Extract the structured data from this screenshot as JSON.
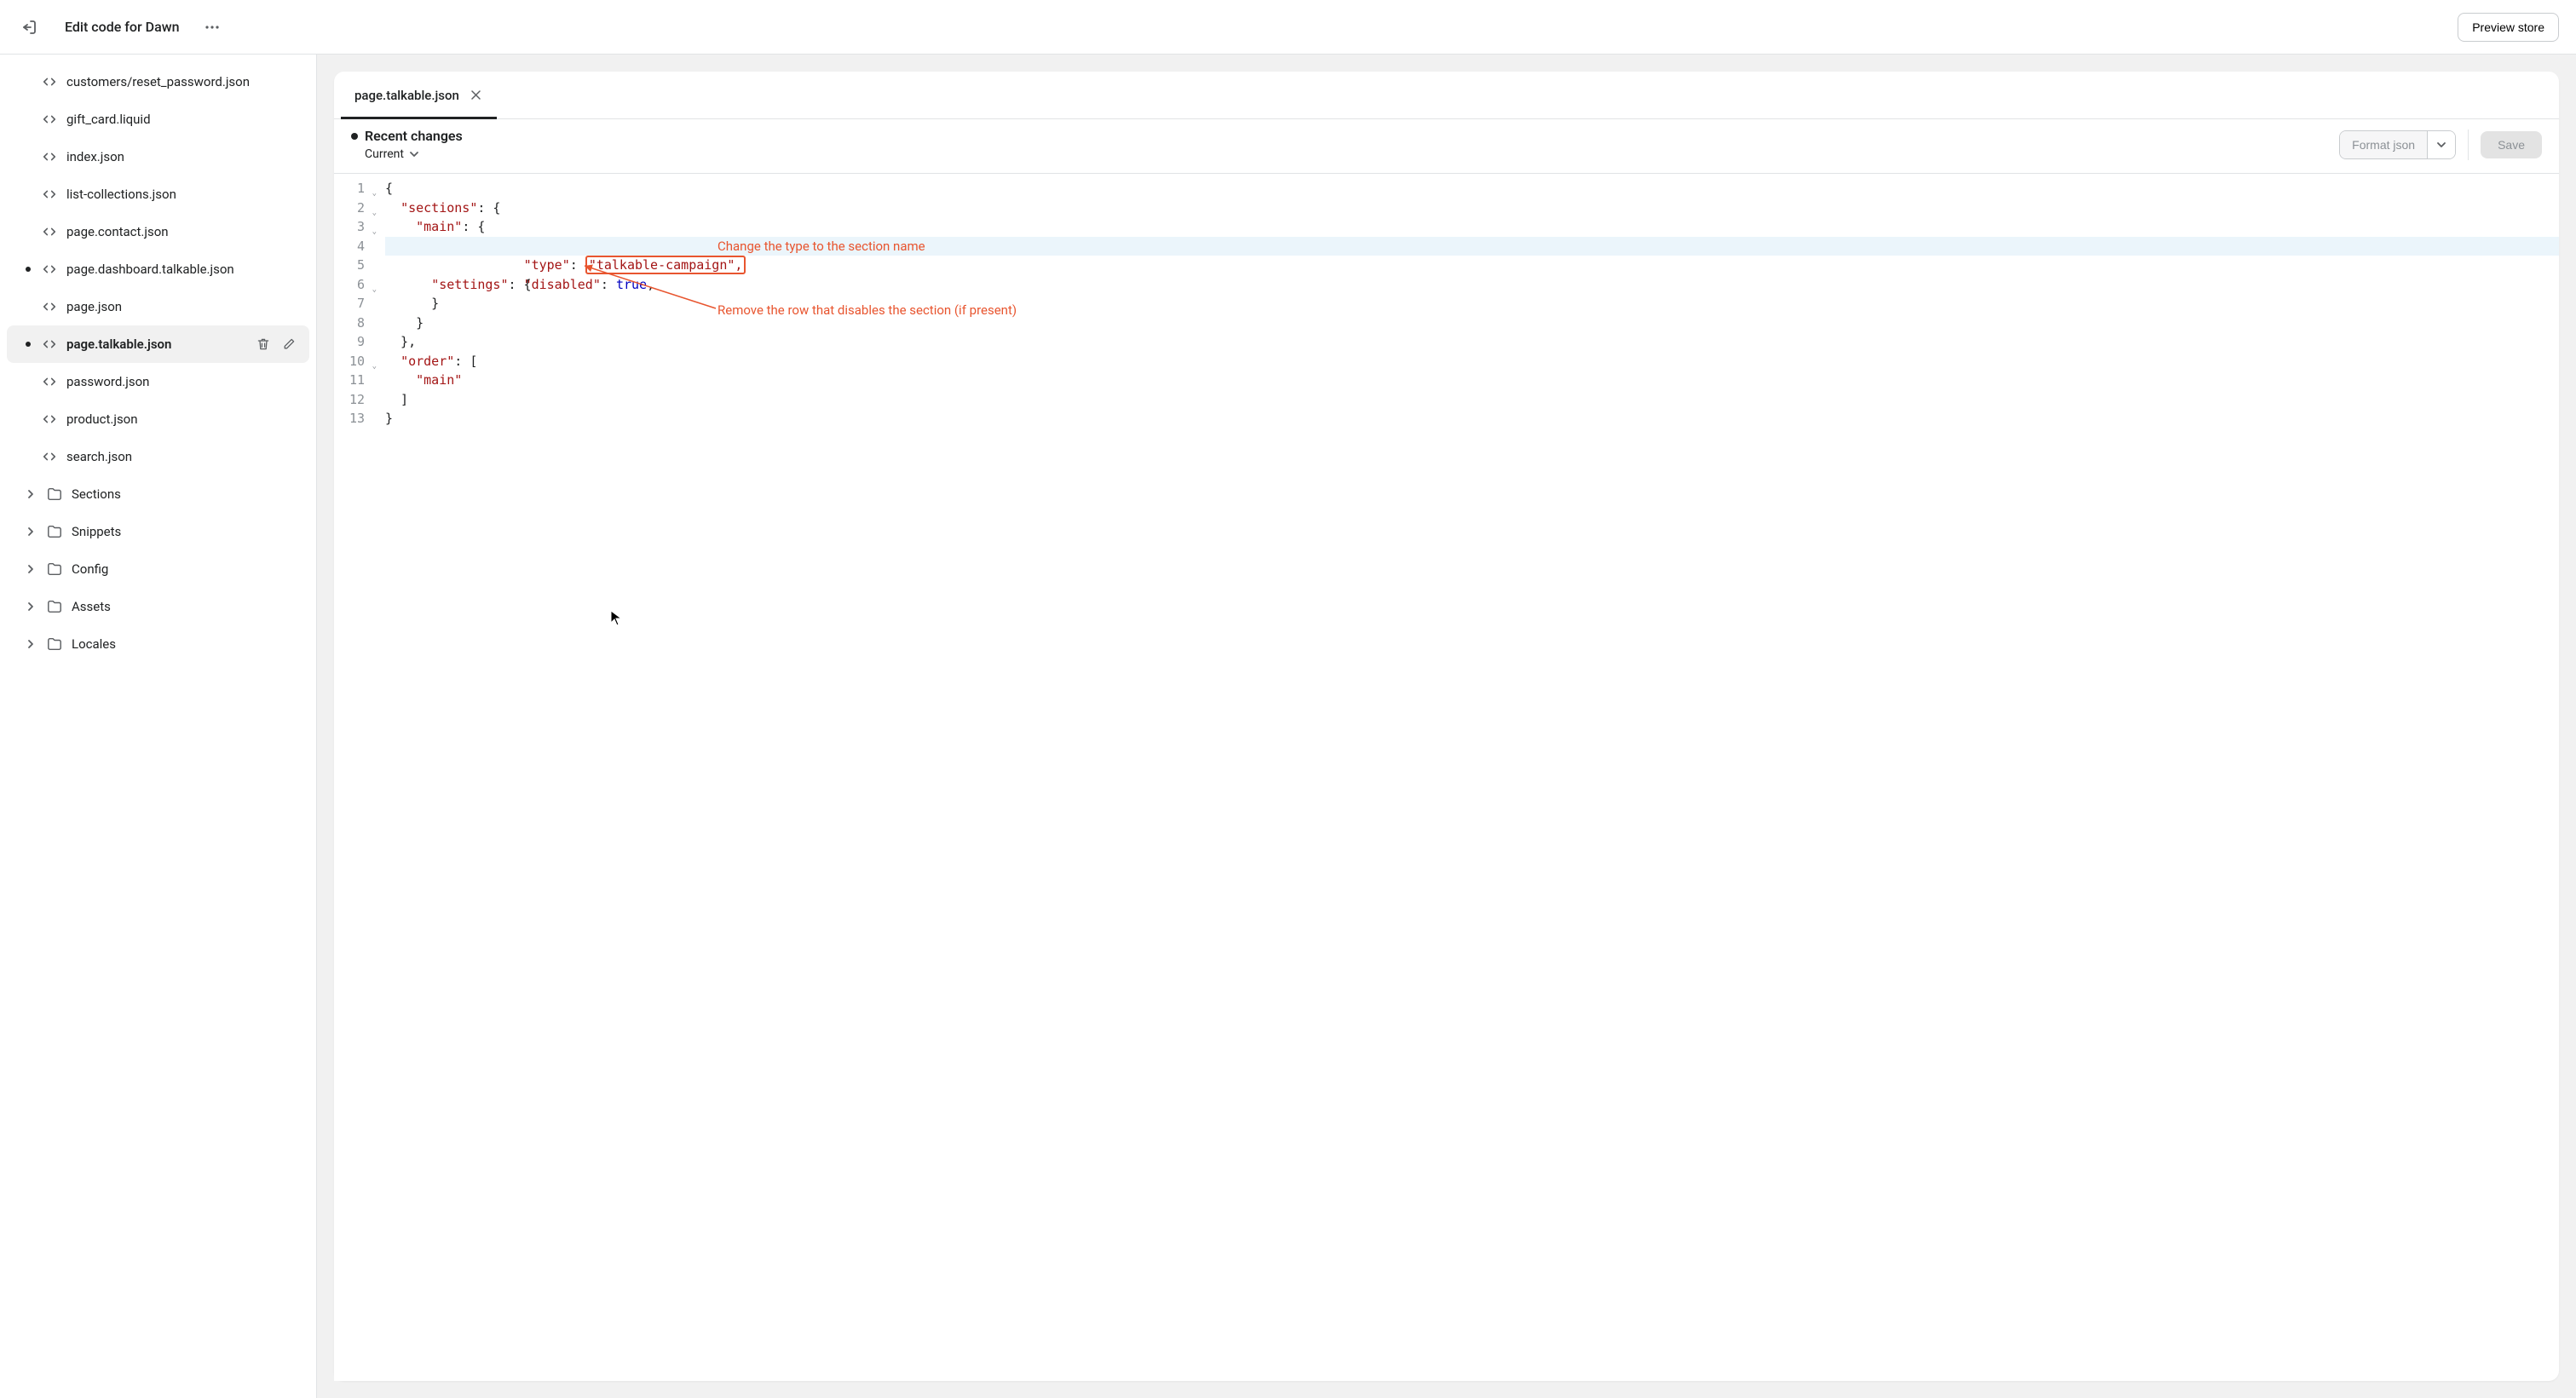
{
  "header": {
    "title": "Edit code for Dawn",
    "preview_label": "Preview store"
  },
  "sidebar": {
    "files": [
      {
        "name": "customers/reset_password.json",
        "modified": false,
        "active": false
      },
      {
        "name": "gift_card.liquid",
        "modified": false,
        "active": false
      },
      {
        "name": "index.json",
        "modified": false,
        "active": false
      },
      {
        "name": "list-collections.json",
        "modified": false,
        "active": false
      },
      {
        "name": "page.contact.json",
        "modified": false,
        "active": false
      },
      {
        "name": "page.dashboard.talkable.json",
        "modified": true,
        "active": false
      },
      {
        "name": "page.json",
        "modified": false,
        "active": false
      },
      {
        "name": "page.talkable.json",
        "modified": true,
        "active": true
      },
      {
        "name": "password.json",
        "modified": false,
        "active": false
      },
      {
        "name": "product.json",
        "modified": false,
        "active": false
      },
      {
        "name": "search.json",
        "modified": false,
        "active": false
      }
    ],
    "folders": [
      {
        "name": "Sections"
      },
      {
        "name": "Snippets"
      },
      {
        "name": "Config"
      },
      {
        "name": "Assets"
      },
      {
        "name": "Locales"
      }
    ]
  },
  "editor": {
    "tab_label": "page.talkable.json",
    "recent_title": "Recent changes",
    "version_label": "Current",
    "format_label": "Format json",
    "save_label": "Save",
    "annotations": {
      "type_note": "Change the type to the section name",
      "disabled_note": "Remove the row that disables the section (if present)"
    },
    "code": {
      "line1": "{",
      "line2_indent": "  ",
      "line2_key": "\"sections\"",
      "line2_rest": ": {",
      "line3_indent": "    ",
      "line3_key": "\"main\"",
      "line3_rest": ": {",
      "line4_indent": "      ",
      "line4_key": "\"type\"",
      "line4_colon": ": ",
      "line4_val": "\"talkable-campaign\",",
      "line5_indent": "      ",
      "line5_key": "\"disabled\"",
      "line5_colon": ": ",
      "line5_val": "true",
      "line5_comma": ",",
      "line6_indent": "      ",
      "line6_key": "\"settings\"",
      "line6_rest": ": {",
      "line7": "      }",
      "line8": "    }",
      "line9": "  },",
      "line10_indent": "  ",
      "line10_key": "\"order\"",
      "line10_rest": ": [",
      "line11_indent": "    ",
      "line11_val": "\"main\"",
      "line12": "  ]",
      "line13": "}"
    },
    "line_numbers": [
      "1",
      "2",
      "3",
      "4",
      "5",
      "6",
      "7",
      "8",
      "9",
      "10",
      "11",
      "12",
      "13"
    ],
    "fold_lines": [
      1,
      2,
      3,
      6,
      10
    ]
  }
}
